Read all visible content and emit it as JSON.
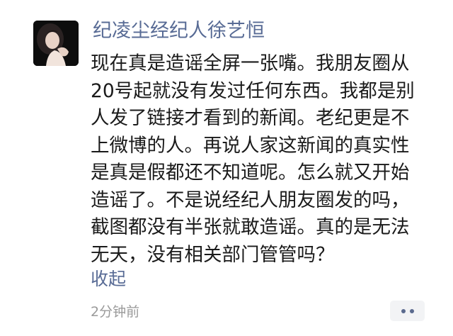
{
  "post": {
    "author": "纪凌尘经纪人徐艺恒",
    "lines": [
      "现在真是造谣全屏一张嘴。我朋友圈从",
      "20号起就没有发过任何东西。我都是别",
      "人发了链接才看到的新闻。老纪更是不",
      "上微博的人。再说人家这新闻的真实性",
      "是真是假都还不知道呢。怎么就又开始",
      "造谣了。不是说经纪人朋友圈发的吗，",
      "截图都没有半张就敢造谣。真的是无法",
      "无天，没有相关部门管管吗？"
    ],
    "collapse_label": "收起",
    "timestamp": "2分钟前",
    "more_icon": "more-dots-icon"
  },
  "colors": {
    "link": "#586b95",
    "text": "#1a1a1a",
    "meta": "#9a9a9a",
    "button_bg": "#f2f3f5"
  }
}
